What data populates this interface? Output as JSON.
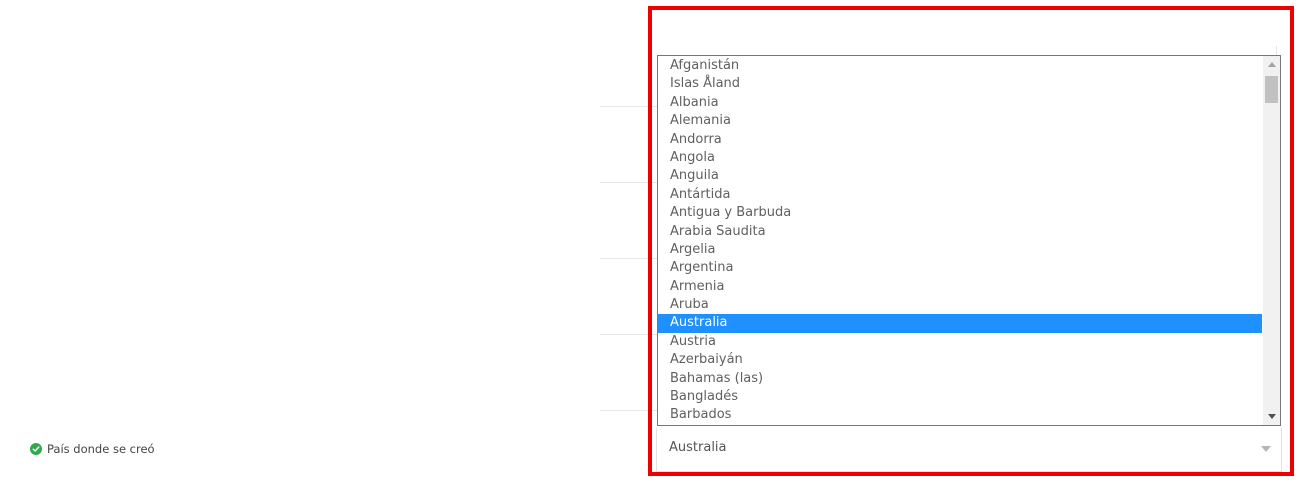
{
  "form": {
    "field_label": "País donde se creó",
    "status_color": "#2eaa4a"
  },
  "select": {
    "value": "Australia"
  },
  "dropdown": {
    "selected": "Australia",
    "options": [
      "Afganistán",
      "Islas Åland",
      "Albania",
      "Alemania",
      "Andorra",
      "Angola",
      "Anguila",
      "Antártida",
      "Antigua y Barbuda",
      "Arabia Saudita",
      "Argelia",
      "Argentina",
      "Armenia",
      "Aruba",
      "Australia",
      "Austria",
      "Azerbaiyán",
      "Bahamas (las)",
      "Bangladés",
      "Barbados"
    ]
  },
  "colors": {
    "highlight_frame": "#ee0000",
    "selected_option_bg": "#1e90ff"
  },
  "icons": {
    "status": "check-circle-icon",
    "dropdown_arrow": "chevron-down-icon"
  }
}
